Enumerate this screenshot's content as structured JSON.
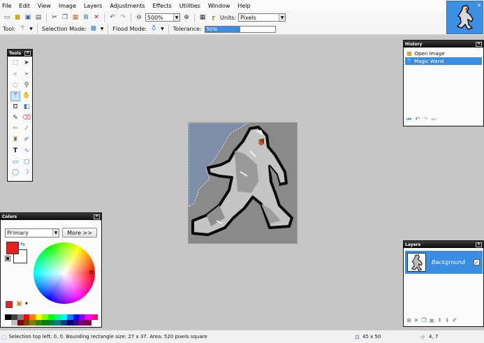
{
  "menubar": {
    "items": [
      "File",
      "Edit",
      "View",
      "Image",
      "Layers",
      "Adjustments",
      "Effects",
      "Utilities",
      "Window",
      "Help"
    ]
  },
  "toolbar": {
    "zoom_value": "500%",
    "units_label": "Units:",
    "units_value": "Pixels"
  },
  "tool_options": {
    "tool_label": "Tool:",
    "selection_mode_label": "Selection Mode:",
    "flood_mode_label": "Flood Mode:",
    "tolerance_label": "Tolerance:",
    "tolerance_value": "50%",
    "tolerance_fraction": 0.5
  },
  "tools_window": {
    "title": "Tools"
  },
  "colors_window": {
    "title": "Colors",
    "palette_select": "Primary",
    "more_button": "More >>",
    "primary_color": "#e8211e",
    "secondary_color": "#ffffff",
    "palette": [
      "#000000",
      "#3f3f3f",
      "#7f7f7f",
      "#ff0000",
      "#ff7f00",
      "#ffff00",
      "#7fff00",
      "#00ff00",
      "#00ff7f",
      "#00ffff",
      "#007fff",
      "#0000ff",
      "#7f00ff",
      "#ff00ff",
      "#ff007f",
      "#ffffff",
      "#bfbfbf",
      "#7f0000",
      "#7f3f00",
      "#7f7f00",
      "#3f7f00",
      "#007f00",
      "#007f3f",
      "#007f7f",
      "#003f7f",
      "#00007f",
      "#3f007f",
      "#7f007f",
      "#7f003f"
    ]
  },
  "history_window": {
    "title": "History",
    "items": [
      {
        "label": "Open Image",
        "selected": false
      },
      {
        "label": "Magic Wand",
        "selected": true
      }
    ]
  },
  "layers_window": {
    "title": "Layers",
    "layer_name": "Background",
    "visible": true
  },
  "status": {
    "selection_text": "Selection top left: 0, 0. Bounding rectangle size: 27 x 37. Area: 520 pixels square",
    "image_size": "45 x 50",
    "cursor_pos": "4, 7"
  },
  "colors": {
    "accent": "#3d8fe3",
    "selection_blue": "#7b8ea6",
    "window_title_dark": "#0b0b0b"
  }
}
